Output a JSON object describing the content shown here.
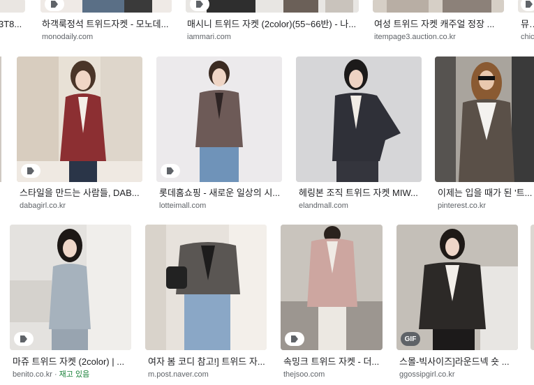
{
  "results": {
    "row0": [
      {
        "title": "3T8...",
        "source": ""
      },
      {
        "title": "하객룩정석 트위드자켓 - 모노데...",
        "source": "monodaily.com"
      },
      {
        "title": "매시니 트위드 자켓 (2color)(55~66반) - 나...",
        "source": "iammari.com"
      },
      {
        "title": "여성 트위드 자켓 캐주얼 정장 ...",
        "source": "itempage3.auction.co.kr"
      },
      {
        "title": "뮤트",
        "source": "chic"
      }
    ],
    "row1": [
      {
        "title": "스타일을 만드는 사람들, DAB...",
        "source": "dabagirl.co.kr",
        "badge": "tag"
      },
      {
        "title": "롯데홈쇼핑 - 새로운 일상의 시...",
        "source": "lotteimall.com",
        "badge": "tag"
      },
      {
        "title": "헤링본 조직 트위드 자켓 MIW...",
        "source": "elandmall.com"
      },
      {
        "title": "이제는 입을 때가 된 '트...",
        "source": "pinterest.co.kr"
      }
    ],
    "row2": [
      {
        "title": "마쥬 트위드 자켓 (2color) | ...",
        "source": "benito.co.kr",
        "stock_sep": "·",
        "stock": "재고 있음",
        "badge": "tag"
      },
      {
        "title": "여자 봄 코디 참고!] 트위드 자...",
        "source": "m.post.naver.com"
      },
      {
        "title": "속밍크 트위드 자켓 - 더...",
        "source": "thejsoo.com",
        "badge": "tag"
      },
      {
        "title": "스몰-빅사이즈]라운드넥 숏 ...",
        "source": "ggossipgirl.co.kr",
        "badge": "GIF"
      }
    ]
  },
  "icons": {
    "badge": "tag-icon"
  },
  "colors": {
    "link_text": "#202124",
    "source_text": "#5f6368",
    "in_stock": "#188038"
  }
}
